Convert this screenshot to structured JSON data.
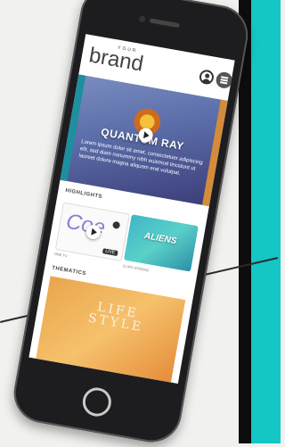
{
  "brand": {
    "small": "YOUR",
    "main": "brand"
  },
  "hero": {
    "title": "QUANTUM RAY",
    "description": "Lorem ipsum dolor sit amet, consectetuer adipiscing elit, sed diam nonummy nibh euismod tincidunt ut laoreet dolore magna aliquam erat volutpat."
  },
  "sections": {
    "highlights": "HIGHLIGHTS",
    "thematics": "THEMATICS"
  },
  "cards": [
    {
      "art": "Coe",
      "badge": "LIVE",
      "caption": "ONE TV"
    },
    {
      "art": "ALIENS",
      "caption": "CLIPS STRONG"
    }
  ],
  "thematic": {
    "title": "LIFE\nSTYLE"
  },
  "colors": {
    "accent": "#14c6c4",
    "phone": "#1d1d1f"
  }
}
